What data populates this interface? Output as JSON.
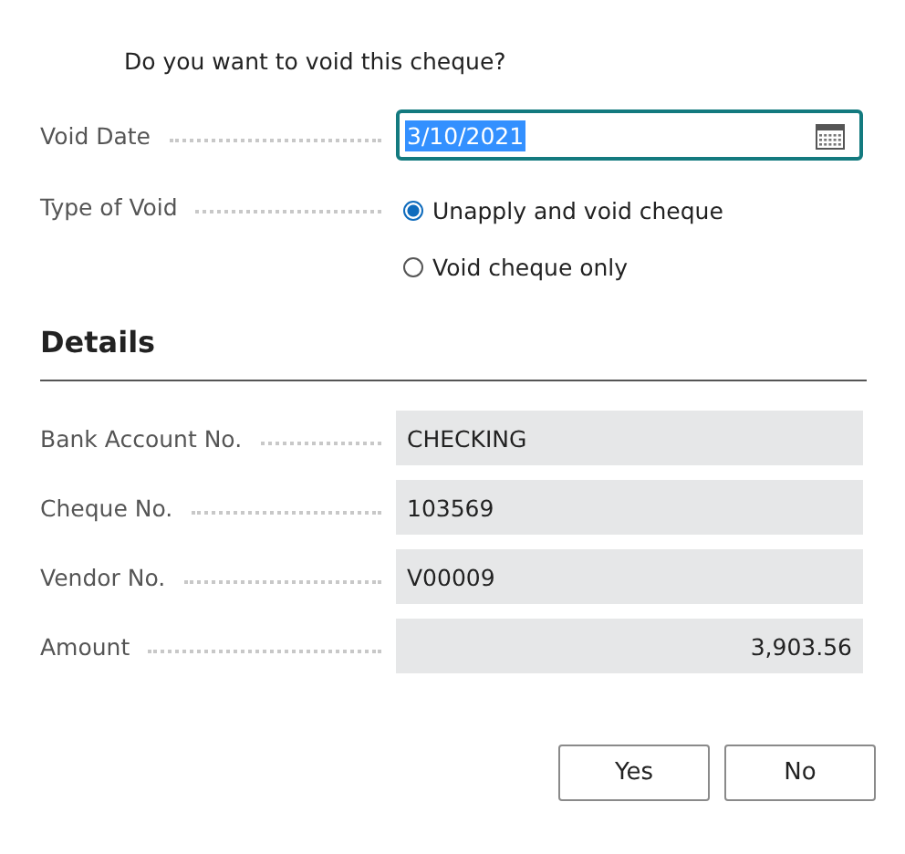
{
  "prompt": "Do you want to void this cheque?",
  "void_date": {
    "label": "Void Date",
    "value": "3/10/2021",
    "text_selected": true
  },
  "type_of_void": {
    "label": "Type of Void",
    "options": [
      {
        "label": "Unapply and void cheque",
        "selected": true
      },
      {
        "label": "Void cheque only",
        "selected": false
      }
    ]
  },
  "details": {
    "heading": "Details",
    "fields": [
      {
        "label": "Bank Account No.",
        "value": "CHECKING",
        "kind": "text"
      },
      {
        "label": "Cheque No.",
        "value": "103569",
        "kind": "text"
      },
      {
        "label": "Vendor No.",
        "value": "V00009",
        "kind": "text"
      },
      {
        "label": "Amount",
        "value": "3,903.56",
        "kind": "number"
      }
    ]
  },
  "buttons": [
    "Yes",
    "No"
  ]
}
